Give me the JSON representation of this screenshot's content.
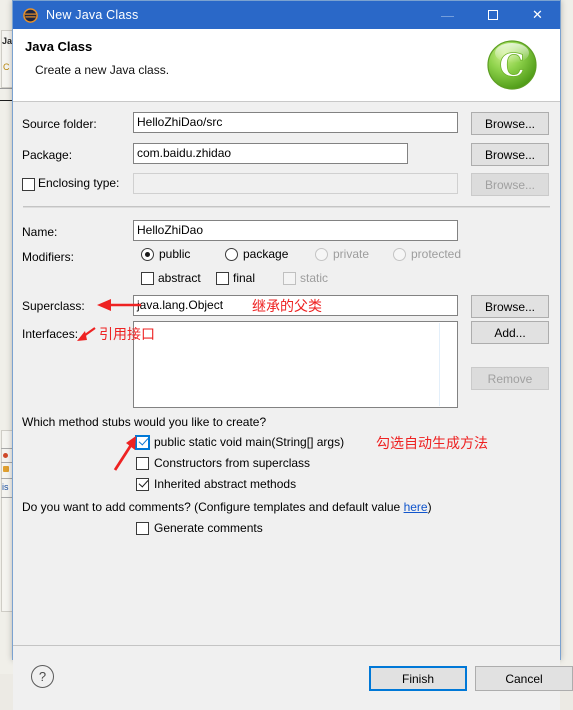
{
  "window": {
    "title": "New Java Class",
    "icon": "eclipse-sphere-icon",
    "minimize_label": "—",
    "maximize_label": "maximize-square",
    "close_label": "✕",
    "titlebar_color": "#2a68c8"
  },
  "header": {
    "title": "Java Class",
    "subtitle": "Create a new Java class.",
    "icon": "green-class-c-icon",
    "icon_letter": "C",
    "icon_color": "#7cc63f"
  },
  "form": {
    "source_folder": {
      "label": "Source folder:",
      "value": "HelloZhiDao/src",
      "browse": "Browse..."
    },
    "package": {
      "label": "Package:",
      "value": "com.baidu.zhidao",
      "browse": "Browse..."
    },
    "enclosing_type": {
      "label": "Enclosing type:",
      "value": "",
      "checked": false,
      "browse": "Browse...",
      "browse_disabled": true,
      "field_disabled": true
    },
    "name": {
      "label": "Name:",
      "value": "HelloZhiDao"
    },
    "modifiers": {
      "label": "Modifiers:",
      "radios": [
        {
          "label": "public",
          "checked": true,
          "disabled": false
        },
        {
          "label": "package",
          "checked": false,
          "disabled": false
        },
        {
          "label": "private",
          "checked": false,
          "disabled": true
        },
        {
          "label": "protected",
          "checked": false,
          "disabled": true
        }
      ],
      "checkboxes": [
        {
          "label": "abstract",
          "checked": false,
          "disabled": false
        },
        {
          "label": "final",
          "checked": false,
          "disabled": false
        },
        {
          "label": "static",
          "checked": false,
          "disabled": true
        }
      ]
    },
    "superclass": {
      "label": "Superclass:",
      "value": "java.lang.Object",
      "browse": "Browse..."
    },
    "interfaces": {
      "label": "Interfaces:",
      "items": [],
      "add": "Add...",
      "remove": "Remove",
      "remove_disabled": true
    }
  },
  "stubs": {
    "question": "Which method stubs would you like to create?",
    "options": [
      {
        "label": "public static void main(String[] args)",
        "checked": true,
        "focused": true
      },
      {
        "label": "Constructors from superclass",
        "checked": false,
        "focused": false
      },
      {
        "label": "Inherited abstract methods",
        "checked": true,
        "focused": false
      }
    ]
  },
  "comments": {
    "question_pre": "Do you want to add comments? (Configure templates and default value ",
    "link": "here",
    "question_post": ")",
    "checkbox": {
      "label": "Generate comments",
      "checked": false
    }
  },
  "footer": {
    "help": "?",
    "finish": "Finish",
    "cancel": "Cancel",
    "default_button": "Finish"
  },
  "annotations": [
    {
      "id": "superclass-note",
      "text": "继承的父类",
      "color": "#ee2222"
    },
    {
      "id": "interfaces-note",
      "text": "引用接口",
      "color": "#ee2222"
    },
    {
      "id": "main-method-note",
      "text": "勾选自动生成方法",
      "color": "#ee2222"
    }
  ],
  "background_window": {
    "fragments": [
      "Ja",
      "C",
      "is"
    ]
  }
}
